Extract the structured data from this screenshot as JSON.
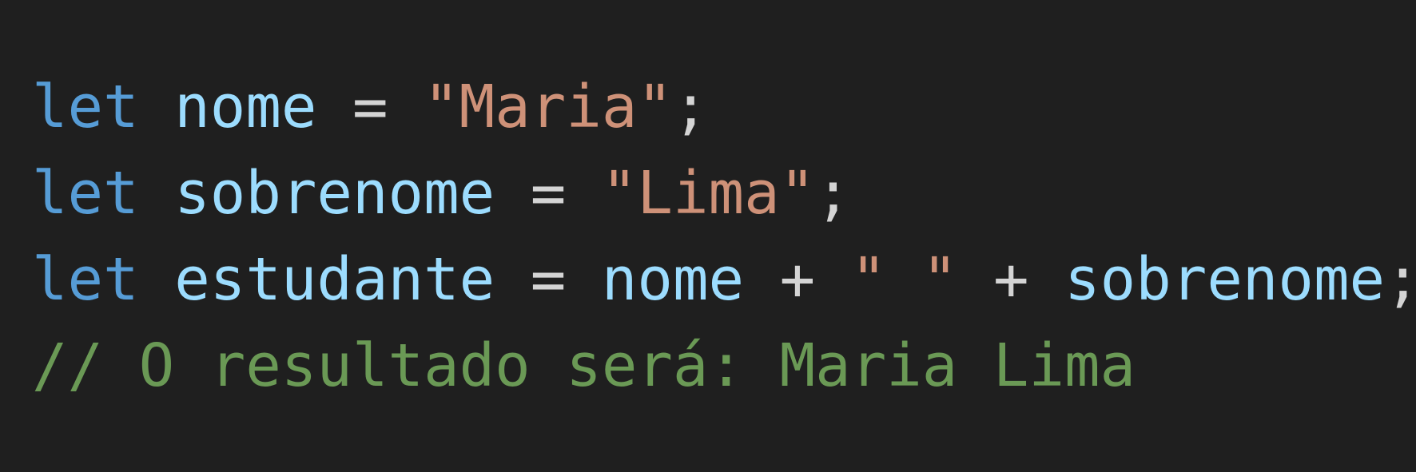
{
  "colors": {
    "background": "#1f1f1f",
    "keyword": "#569cd6",
    "variable": "#9cdcfe",
    "operator": "#d4d4d4",
    "string": "#ce9178",
    "comment": "#6a9955"
  },
  "code": {
    "line1": {
      "keyword": "let",
      "name": "nome",
      "assign": "=",
      "string": "\"Maria\"",
      "end": ";"
    },
    "line2": {
      "keyword": "let",
      "name": "sobrenome",
      "assign": "=",
      "string": "\"Lima\"",
      "end": ";"
    },
    "line3": {
      "keyword": "let",
      "name": "estudante",
      "assign": "=",
      "operand1": "nome",
      "plus1": "+",
      "string": "\" \"",
      "plus2": "+",
      "operand2": "sobrenome",
      "end": ";"
    },
    "line4": {
      "comment": "// O resultado será: Maria Lima"
    }
  }
}
